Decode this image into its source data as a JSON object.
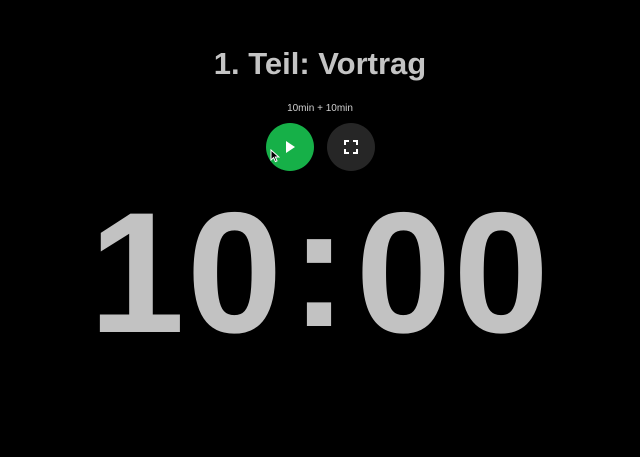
{
  "app": {
    "title": "1. Teil: Vortrag",
    "subtitle": "10min + 10min"
  },
  "controls": {
    "play_icon": "play-icon",
    "fullscreen_icon": "fullscreen-icon",
    "play_color": "#16b048",
    "fullscreen_color": "#262626"
  },
  "timer": {
    "minutes": "10",
    "separator": ":",
    "seconds": "00"
  }
}
